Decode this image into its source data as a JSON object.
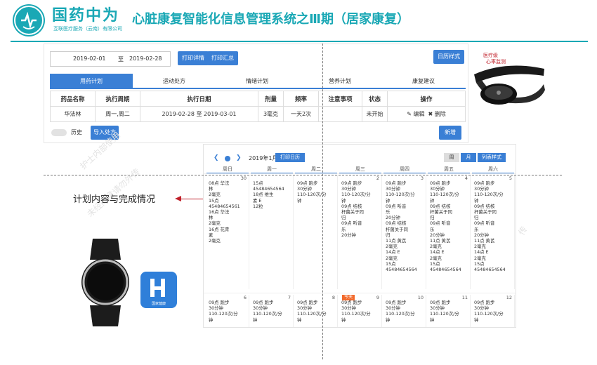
{
  "header": {
    "brand_name": "国药中为",
    "brand_sub": "互联医疗服务（云南）有限公司",
    "title": "心脏康复智能化信息管理系统之Ⅲ期（居家康复）"
  },
  "colors": {
    "brand": "#1aa8b5",
    "accent": "#3a7fd5",
    "today": "#f26a2c",
    "arrow": "#c0202a"
  },
  "top_app": {
    "date_from": "2019-02-01",
    "date_sep": "至",
    "date_to": "2019-02-28",
    "btn_print_detail": "打印详情",
    "btn_print_summary": "打印汇总",
    "btn_calendar_style": "日历样式",
    "tabs": [
      "用药计划",
      "运动处方",
      "情绪计划",
      "营养计划",
      "康复建议"
    ],
    "columns": [
      "药品名称",
      "执行周期",
      "执行日期",
      "剂量",
      "频率",
      "注意事项",
      "状态",
      "操作"
    ],
    "rows": [
      {
        "name": "华法林",
        "period": "周一,周二",
        "dates": "2019-02-28 至 2019-03-01",
        "dose": "3毫克",
        "freq": "一天2次",
        "notes": "",
        "status": "未开始",
        "edit": "编辑",
        "delete": "删除"
      }
    ],
    "history_label": "历史",
    "btn_import": "导入处方",
    "btn_add": "新增"
  },
  "product_belt": {
    "label_line1": "医疗级",
    "label_line2": "心率监测"
  },
  "calendar": {
    "prev_icon": "chevron-left-icon",
    "next_icon": "chevron-right-icon",
    "month": "2019年1月",
    "btn_print": "打印日历",
    "views": [
      "周",
      "月",
      "列表样式"
    ],
    "weekdays": [
      "周日",
      "周一",
      "周二",
      "周三",
      "周四",
      "周五",
      "周六"
    ],
    "today_label": "今天",
    "week1": [
      {
        "day": "30",
        "lines": [
          "08点 华法",
          "林",
          "2毫克",
          "15点",
          "45484654561",
          "16点 华法",
          "林",
          "2毫克",
          "16点 花青",
          "素",
          "2毫克"
        ]
      },
      {
        "day": "",
        "lines": [
          "15点",
          "45484654564",
          "18点 维生",
          "素 E",
          "12粒"
        ]
      },
      {
        "day": "",
        "lines": [
          "09点 跑步",
          "30分钟",
          "110-120次/分",
          "钟"
        ]
      },
      {
        "day": "2",
        "lines": [
          "09点 跑步",
          "30分钟",
          "110-120次/分",
          "钟",
          "09点 结核",
          "杆菌关于同",
          "归",
          "09点 听音",
          "乐",
          "20分钟"
        ]
      },
      {
        "day": "3",
        "lines": [
          "09点 跑步",
          "30分钟",
          "110-120次/分",
          "钟",
          "09点 听音",
          "乐",
          "20分钟",
          "09点 结核",
          "杆菌关于同",
          "归",
          "11点 黄芪",
          "2毫克",
          "14点 E",
          "2毫克",
          "15点",
          "45484654564"
        ]
      },
      {
        "day": "4",
        "lines": [
          "09点 跑步",
          "30分钟",
          "110-120次/分",
          "钟",
          "09点 结核",
          "杆菌关于同",
          "归",
          "09点 听音",
          "乐",
          "20分钟",
          "11点 黄芪",
          "2毫克",
          "14点 E",
          "2毫克",
          "15点",
          "45484654564"
        ]
      },
      {
        "day": "5",
        "lines": [
          "09点 跑步",
          "30分钟",
          "110-120次/分",
          "钟",
          "09点 结核",
          "杆菌关于同",
          "归",
          "09点 听音",
          "乐",
          "20分钟",
          "11点 黄芪",
          "2毫克",
          "14点 E",
          "2毫克",
          "15点",
          "45484654564"
        ]
      }
    ],
    "week2": [
      {
        "day": "6",
        "lines": [
          "09点 跑步",
          "30分钟",
          "110-120次/分",
          "钟"
        ]
      },
      {
        "day": "7",
        "lines": [
          "09点 跑步",
          "30分钟",
          "110-120次/分",
          "钟"
        ]
      },
      {
        "day": "8",
        "lines": [
          "09点 跑步",
          "30分钟",
          "110-120次/分",
          "钟"
        ]
      },
      {
        "day": "9",
        "today": true,
        "lines": [
          "09点 跑步",
          "30分钟",
          "110-120次/分",
          "钟"
        ]
      },
      {
        "day": "10",
        "lines": [
          "09点 跑步",
          "30分钟",
          "110-120次/分",
          "钟"
        ]
      },
      {
        "day": "11",
        "lines": [
          "09点 跑步",
          "30分钟",
          "110-120次/分",
          "钟"
        ]
      },
      {
        "day": "12",
        "lines": [
          "09点 跑步",
          "30分钟",
          "110-120次/分",
          "钟"
        ]
      }
    ]
  },
  "callout": "计划内容与完成情况",
  "watermark_1": "未经同意请勿外传",
  "watermark_2": "护士内部使用",
  "watermark_3": "传",
  "app_icon": {
    "glyph": "H",
    "label": "国家健康"
  }
}
